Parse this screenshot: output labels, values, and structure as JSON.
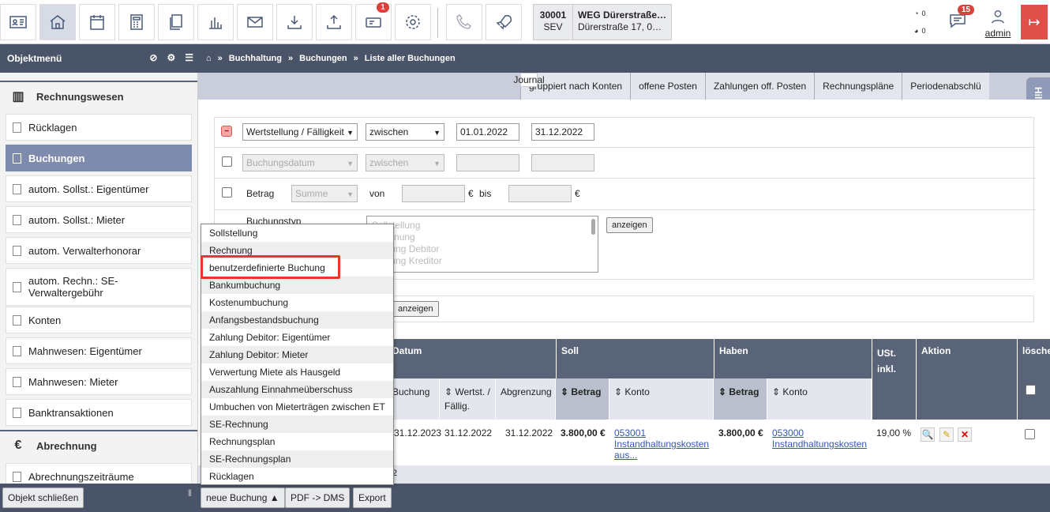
{
  "toolbar": {
    "notification_count": "1",
    "messages_count": "15",
    "counters": [
      "0",
      "0"
    ],
    "user": "admin"
  },
  "object": {
    "number": "30001",
    "code": "SEV",
    "name": "WEG Dürerstraße…",
    "address": "Dürerstraße 17, 0…"
  },
  "sidebar": {
    "title": "Objektmenü",
    "section1": "Rechnungswesen",
    "items": [
      "Rücklagen",
      "Buchungen",
      "autom. Sollst.: Eigentümer",
      "autom. Sollst.: Mieter",
      "autom. Verwalterhonorar",
      "autom. Rechn.: SE-Verwaltergebühr",
      "Konten",
      "Mahnwesen: Eigentümer",
      "Mahnwesen: Mieter",
      "Banktransaktionen"
    ],
    "section2": "Abrechnung",
    "items2": [
      "Abrechnungszeiträume"
    ]
  },
  "breadcrumb": {
    "b1": "Buchhaltung",
    "b2": "Buchungen",
    "b3": "Liste aller Buchungen"
  },
  "tabs": [
    "Journal",
    "gruppiert nach Konten",
    "offene Posten",
    "Zahlungen off. Posten",
    "Rechnungspläne",
    "Periodenabschlü"
  ],
  "help": "Hilfe",
  "filter": {
    "row1_field": "Wertstellung / Fälligkeit",
    "row1_op": "zwischen",
    "row1_from": "01.01.2022",
    "row1_to": "31.12.2022",
    "row2_field": "Buchungsdatum",
    "row2_op": "zwischen",
    "row3_label": "Betrag",
    "row3_field": "Summe",
    "row3_von": "von",
    "row3_bis": "bis",
    "euro": "€",
    "row4_label": "Buchungstyp",
    "listbox": [
      "Sollstellung",
      "Rechnung",
      "Zahlung Debitor",
      "Zahlung Kreditor"
    ],
    "show_button": "anzeigen",
    "show_button2": "anzeigen"
  },
  "table": {
    "h_datum": "Datum",
    "h_soll": "Soll",
    "h_haben": "Haben",
    "h_ust": "USt. inkl.",
    "h_aktion": "Aktion",
    "h_loeschen": "lösche",
    "h_buchung": "Buchung",
    "h_wertst": "Wertst. / Fällig.",
    "h_abgrenzung": "Abgrenzung",
    "h_betrag": "Betrag",
    "h_konto": "Konto",
    "row": {
      "buchung": "31.12.2023",
      "wertst": "31.12.2022",
      "abgrenzung": "31.12.2022",
      "soll_betrag": "3.800,00 €",
      "soll_konto": "053001 Instandhaltungskosten aus...",
      "haben_betrag": "3.800,00 €",
      "haben_konto": "053000 Instandhaltungskosten",
      "ust": "19,00 %"
    },
    "footer_num": "2"
  },
  "dropdown": [
    "Sollstellung",
    "Rechnung",
    "benutzerdefinierte Buchung",
    "Bankumbuchung",
    "Kostenumbuchung",
    "Anfangsbestandsbuchung",
    "Zahlung Debitor: Eigentümer",
    "Zahlung Debitor: Mieter",
    "Verwertung Miete als Hausgeld",
    "Auszahlung Einnahmeüberschuss",
    "Umbuchen von Mieterträgen zwischen ET",
    "SE-Rechnung",
    "Rechnungsplan",
    "SE-Rechnungsplan",
    "Rücklagen"
  ],
  "bottom": {
    "close": "Objekt schließen",
    "new": "neue Buchung",
    "pdf": "PDF -> DMS",
    "export": "Export"
  }
}
